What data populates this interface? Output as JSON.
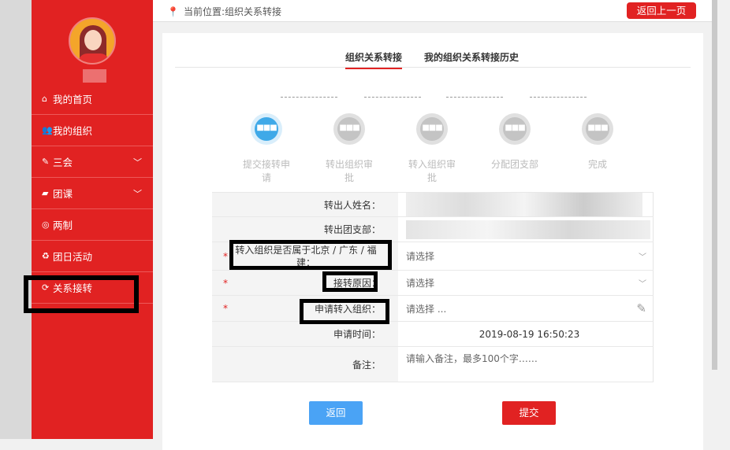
{
  "sidebar": {
    "items": [
      {
        "label": "我的首页",
        "icon": "home-icon"
      },
      {
        "label": "我的组织",
        "icon": "users-icon"
      },
      {
        "label": "三会",
        "icon": "edit-icon"
      },
      {
        "label": "团课",
        "icon": "folder-open-icon"
      },
      {
        "label": "两制",
        "icon": "target-icon"
      },
      {
        "label": "团日活动",
        "icon": "recycle-icon"
      },
      {
        "label": "关系接转",
        "icon": "refresh-icon"
      }
    ]
  },
  "topbar": {
    "location": "当前位置:组织关系转接",
    "back": "返回上一页"
  },
  "tabs": [
    "组织关系转接",
    "我的组织关系转接历史"
  ],
  "steps": [
    "提交接转申请",
    "转出组织审批",
    "转入组织审批",
    "分配团支部",
    "完成"
  ],
  "form": {
    "name_label": "转出人姓名：",
    "branch_label": "转出团支部：",
    "region_label": "转入组织是否属于北京 / 广东 / 福建：",
    "region_placeholder": "请选择",
    "reason_label": "接转原因：",
    "reason_placeholder": "请选择",
    "target_label": "申请转入组织：",
    "target_placeholder": "请选择 ...",
    "time_label": "申请时间：",
    "time_value": "2019-08-19 16:50:23",
    "note_label": "备注：",
    "note_placeholder": "请输入备注，最多100个字……"
  },
  "buttons": {
    "back": "返回",
    "submit": "提交"
  },
  "colors": {
    "accent": "#e12222",
    "step_active": "#3fa9e8",
    "back_button": "#4aa3f5"
  }
}
